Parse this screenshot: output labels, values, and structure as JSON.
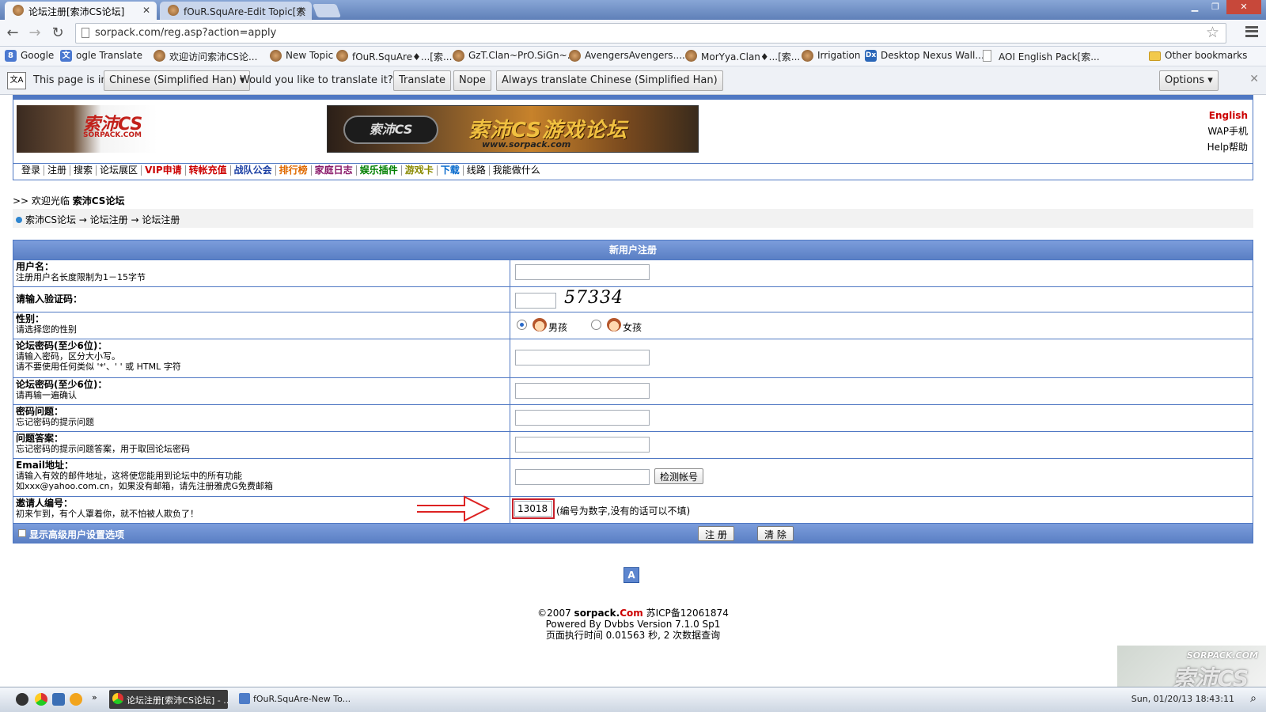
{
  "browser": {
    "tabs": [
      {
        "title": "论坛注册[索沛CS论坛]"
      },
      {
        "title": "fOuR.SquAre-Edit Topic[索"
      }
    ],
    "url": "sorpack.com/reg.asp?action=apply",
    "bookmarks": [
      "Google",
      "ogle Translate",
      "欢迎访问索沛CS论...",
      "New Topic",
      "fOuR.SquAre♦...[索...",
      "GzT.Clan~PrO.SiGn~...",
      "AvengersAvengers......",
      "MorYya.Clan♦...[索...",
      "Irrigation",
      "Desktop Nexus Wall...",
      "AOI English Pack[索...",
      "Other bookmarks"
    ]
  },
  "translate_bar": {
    "prefix": "This page is in",
    "language": "Chinese (Simplified Han)",
    "question": "Would you like to translate it?",
    "translate": "Translate",
    "nope": "Nope",
    "always": "Always translate Chinese (Simplified Han)",
    "options": "Options"
  },
  "site": {
    "logo_text": "索沛CS",
    "logo_sub": "SORPACK.COM",
    "banner_badge": "索沛CS",
    "banner_text": "索沛CS游戏论坛",
    "banner_url": "www.sorpack.com",
    "lang_links": [
      "English",
      "WAP手机",
      "Help帮助"
    ],
    "nav": [
      "登录",
      "注册",
      "搜索",
      "论坛展区",
      "VIP申请",
      "转帐充值",
      "战队公会",
      "排行榜",
      "家庭日志",
      "娱乐插件",
      "游戏卡",
      "下载",
      "线路",
      "我能做什么"
    ],
    "nav_colors": [
      "#000000",
      "#000000",
      "#000000",
      "#000000",
      "#cc0000",
      "#cc0000",
      "#1b3fa3",
      "#e06a00",
      "#8a1a6a",
      "#008000",
      "#8a8a00",
      "#0066cc",
      "#000000",
      "#000000"
    ],
    "welcome_prefix": ">> 欢迎光临",
    "welcome_name": "索沛CS论坛",
    "breadcrumb": "索沛CS论坛 → 论坛注册 → 论坛注册"
  },
  "form": {
    "title": "新用户注册",
    "username_label": "用户名：",
    "username_hint": "注册用户名长度限制为1－15字节",
    "captcha_label": "请输入验证码：",
    "captcha_code": "57334",
    "gender_label": "性别：",
    "gender_hint": "请选择您的性别",
    "gender_male": "男孩",
    "gender_female": "女孩",
    "password_label": "论坛密码(至少6位)：",
    "password_hint1": "请输入密码，区分大小写。",
    "password_hint2": "请不要使用任何类似 '*'、' ' 或 HTML 字符",
    "password2_label": "论坛密码(至少6位)：",
    "password2_hint": "请再输一遍确认",
    "question_label": "密码问题：",
    "question_hint": "忘记密码的提示问题",
    "answer_label": "问题答案：",
    "answer_hint": "忘记密码的提示问题答案，用于取回论坛密码",
    "email_label": "Email地址：",
    "email_hint1": "请输入有效的邮件地址，这将使您能用到论坛中的所有功能",
    "email_hint2": "如xxx@yahoo.com.cn，如果没有邮箱，请先注册雅虎G免费邮箱",
    "check_button": "检测帐号",
    "invite_label": "邀请人编号：",
    "invite_hint_left": "初来乍到，有个人罩着你，就不怕被人欺负了！",
    "invite_value": "13018",
    "invite_hint_right": "(编号为数字,没有的话可以不填)",
    "advanced_label": "显示高级用户设置选项",
    "submit": "注 册",
    "clear": "清 除"
  },
  "footer": {
    "copyright_prefix": "©2007",
    "brand": "sorpack.",
    "brand_com": "Com",
    "icp": "苏ICP备12061874",
    "powered": "Powered By Dvbbs Version 7.1.0 Sp1",
    "exec": "页面执行时间 0.01563 秒, 2 次数据查询"
  },
  "taskbar": {
    "task1": "论坛注册[索沛CS论坛] - ...",
    "task2": "fOuR.SquAre-New To...",
    "clock": "Sun, 01/20/13 18:43:11",
    "watermark_small": "SORPACK.COM",
    "watermark_big": "索沛CS"
  }
}
